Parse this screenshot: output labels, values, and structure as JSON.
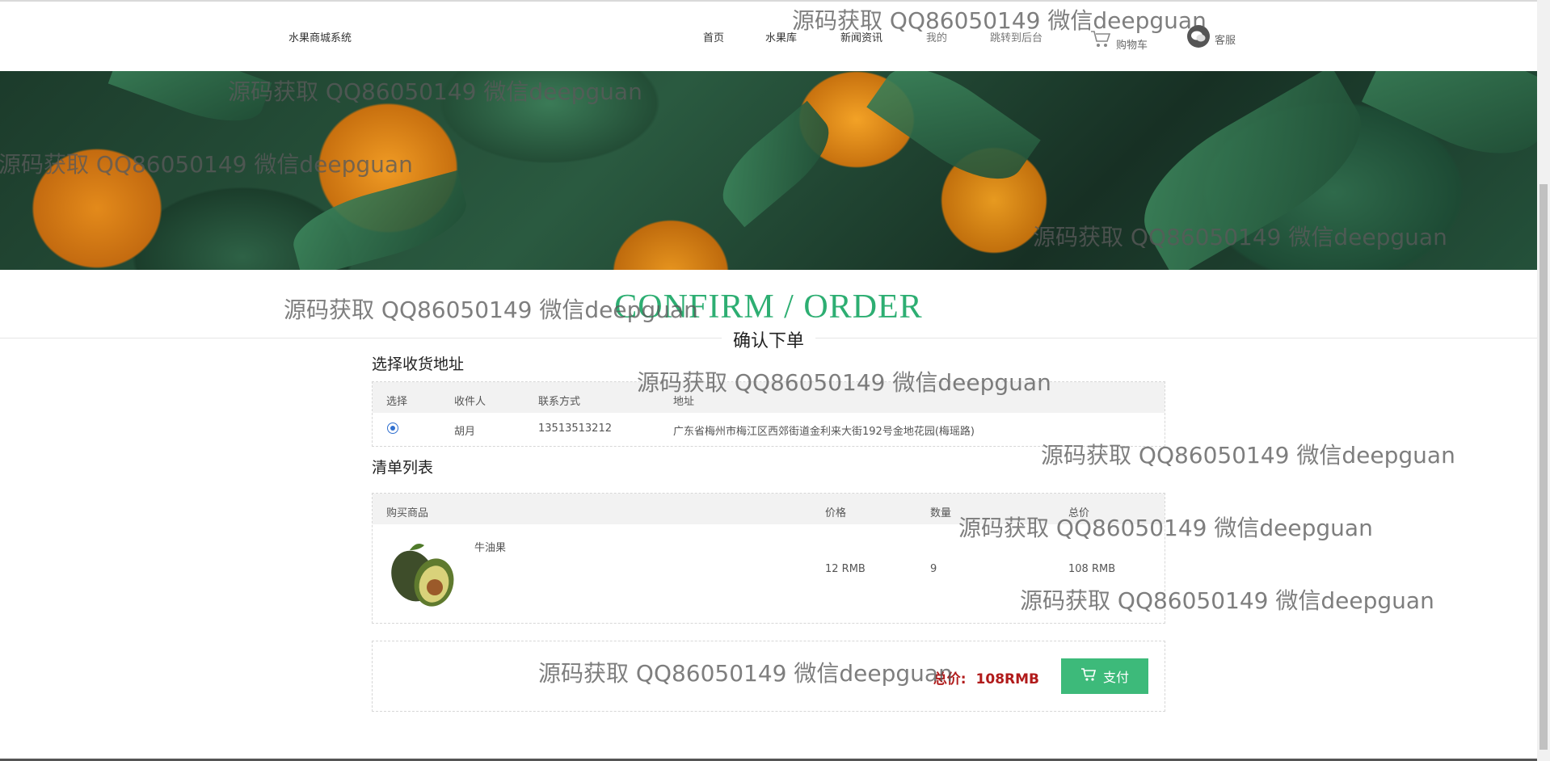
{
  "header": {
    "brand": "水果商城系统",
    "nav": [
      "首页",
      "水果库",
      "新闻资讯",
      "我的",
      "跳转到后台"
    ],
    "cart_label": "购物车",
    "service_label": "客服"
  },
  "watermark": "源码获取 QQ86050149 微信deepguan",
  "page_title": {
    "en": "CONFIRM / ORDER",
    "cn": "确认下单"
  },
  "address_section": {
    "label": "选择收货地址",
    "columns": [
      "选择",
      "收件人",
      "联系方式",
      "地址"
    ],
    "rows": [
      {
        "selected": true,
        "name": "胡月",
        "phone": "13513513212",
        "address": "广东省梅州市梅江区西郊街道金利来大街192号金地花园(梅瑶路)"
      }
    ]
  },
  "items_section": {
    "label": "清单列表",
    "columns": [
      "购买商品",
      "价格",
      "数量",
      "总价"
    ],
    "rows": [
      {
        "product": "牛油果",
        "price": "12 RMB",
        "quantity": "9",
        "total": "108 RMB"
      }
    ]
  },
  "summary": {
    "total_label": "总价:",
    "total_value": "108RMB",
    "pay_label": "支付"
  },
  "colors": {
    "accent": "#2dae72",
    "pay_button": "#3dba7a",
    "total_red": "#b11b1b"
  }
}
